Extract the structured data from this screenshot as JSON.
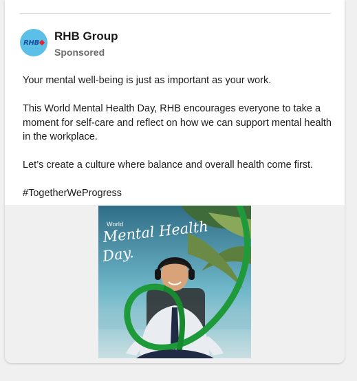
{
  "post": {
    "org_name": "RHB Group",
    "sponsored_label": "Sponsored",
    "avatar_text": "RHB",
    "paragraphs": [
      "Your mental well-being is just as important as your work.",
      "This World Mental Health Day, RHB encourages everyone to take a moment for self-care and reflect on how we can support mental health in the workplace.",
      "Let’s create a culture where balance and overall health come first.",
      "#TogetherWeProgress"
    ]
  },
  "media": {
    "world_label": "World",
    "title_line1": "Mental Health",
    "title_line2": "Day."
  },
  "colors": {
    "brand_blue": "#5bbfe8",
    "ribbon_green": "#1f9a3a"
  }
}
